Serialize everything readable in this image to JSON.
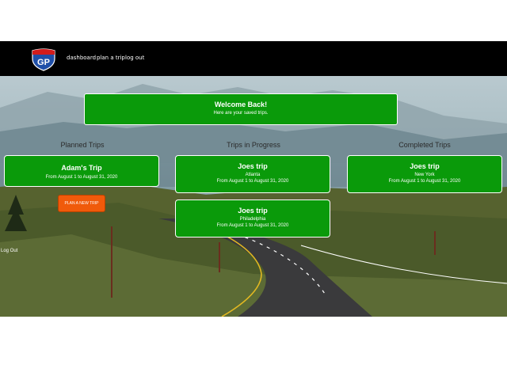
{
  "nav": {
    "logo_text": "GP",
    "logo_colors": {
      "shield": "#1f4fa8",
      "band": "#d21c1c",
      "text": "#ffffff"
    },
    "links": [
      "dashboard",
      "plan a trip",
      "log out"
    ]
  },
  "welcome": {
    "title": "Welcome Back!",
    "subtitle": "Here are your saved trips."
  },
  "columns": {
    "planned": "Planned Trips",
    "in_progress": "Trips in Progress",
    "completed": "Completed Trips"
  },
  "planned_trips": [
    {
      "name": "Adam's Trip",
      "dates": "From August 1 to August 31, 2020"
    }
  ],
  "in_progress_trips": [
    {
      "name": "Joes trip",
      "city": "Atlanta",
      "dates": "From August 1 to August 31, 2020"
    },
    {
      "name": "Joes trip",
      "city": "Philadelphia",
      "dates": "From August 1 to August 31, 2020"
    }
  ],
  "completed_trips": [
    {
      "name": "Joes trip",
      "city": "New York",
      "dates": "From August 1 to August 31, 2020"
    }
  ],
  "plan_button": "PLAN A NEW TRIP",
  "side_logout": "Log Out",
  "colors": {
    "card_green": "#0a9a0a",
    "button_orange": "#f05a0a",
    "navbar": "#000000"
  }
}
